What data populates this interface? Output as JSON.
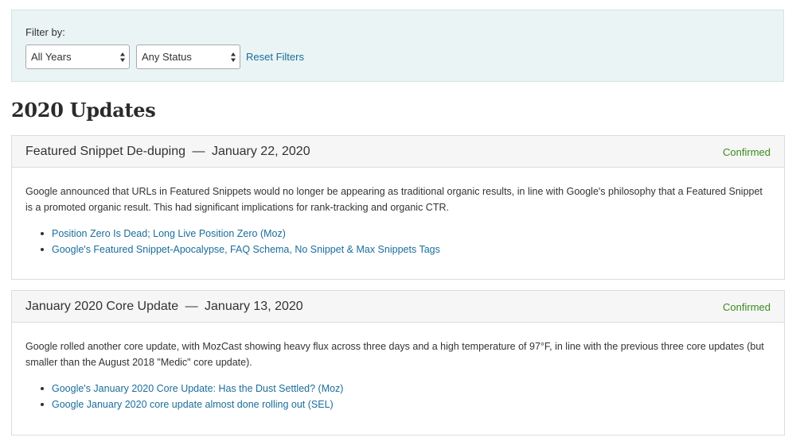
{
  "filter": {
    "label": "Filter by:",
    "years_selected": "All Years",
    "status_selected": "Any Status",
    "reset_label": "Reset Filters"
  },
  "section": {
    "title": "2020 Updates"
  },
  "updates": [
    {
      "name": "Featured Snippet De-duping",
      "date": "January 22, 2020",
      "separator": "—",
      "status": "Confirmed",
      "description": "Google announced that URLs in Featured Snippets would no longer be appearing as traditional organic results, in line with Google's philosophy that a Featured Snippet is a promoted organic result. This had significant implications for rank-tracking and organic CTR.",
      "links": [
        "Position Zero Is Dead; Long Live Position Zero (Moz)",
        "Google's Featured Snippet-Apocalypse, FAQ Schema, No Snippet & Max Snippets Tags"
      ]
    },
    {
      "name": "January 2020 Core Update",
      "date": "January 13, 2020",
      "separator": "—",
      "status": "Confirmed",
      "description": "Google rolled another core update, with MozCast showing heavy flux across three days and a high temperature of 97°F, in line with the previous three core updates (but smaller than the August 2018 \"Medic\" core update).",
      "links": [
        "Google's January 2020 Core Update: Has the Dust Settled? (Moz)",
        "Google January 2020 core update almost done rolling out (SEL)"
      ]
    }
  ],
  "colors": {
    "panel_bg": "#eaf4f4",
    "link": "#1a6d9a",
    "confirmed": "#3b8a1f"
  }
}
